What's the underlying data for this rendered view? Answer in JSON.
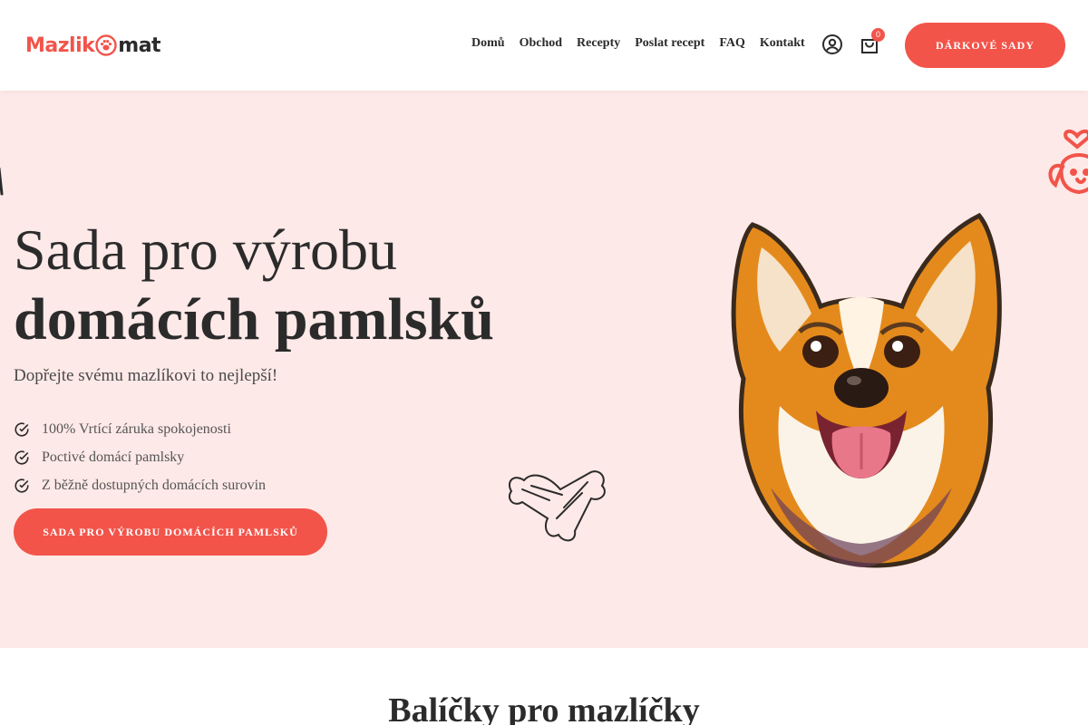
{
  "brand": {
    "logo_part1": "Mazlik",
    "logo_part2": "mat",
    "primary_color": "#f2544a",
    "hero_bg": "#fde9e7"
  },
  "nav": {
    "items": [
      {
        "label": "Domů"
      },
      {
        "label": "Obchod"
      },
      {
        "label": "Recepty"
      },
      {
        "label": "Poslat recept"
      },
      {
        "label": "FAQ"
      },
      {
        "label": "Kontakt"
      }
    ]
  },
  "header": {
    "account_icon": "user-circle-icon",
    "cart_icon": "shopping-bag-icon",
    "cart_count": "0",
    "gift_button": "DÁRKOVÉ SADY"
  },
  "hero": {
    "title_line1": "Sada pro výrobu",
    "title_line2": "domácích pamlsků",
    "subtitle": "Dopřejte svému mazlíkovi to nejlepší!",
    "features": [
      {
        "text": "100% Vrtící záruka spokojenosti",
        "icon": "check-circle-icon"
      },
      {
        "text": "Poctivé domácí pamlsky",
        "icon": "check-circle-icon"
      },
      {
        "text": "Z běžně dostupných domácích surovin",
        "icon": "check-circle-icon"
      }
    ],
    "cta": "SADA PRO VÝROBU DOMÁCÍCH PAMLSKŮ",
    "images": [
      "corgi-illustration",
      "bone-sketch-icon",
      "dog-heart-icon"
    ]
  },
  "section": {
    "title": "Balíčky pro mazlíčky"
  }
}
